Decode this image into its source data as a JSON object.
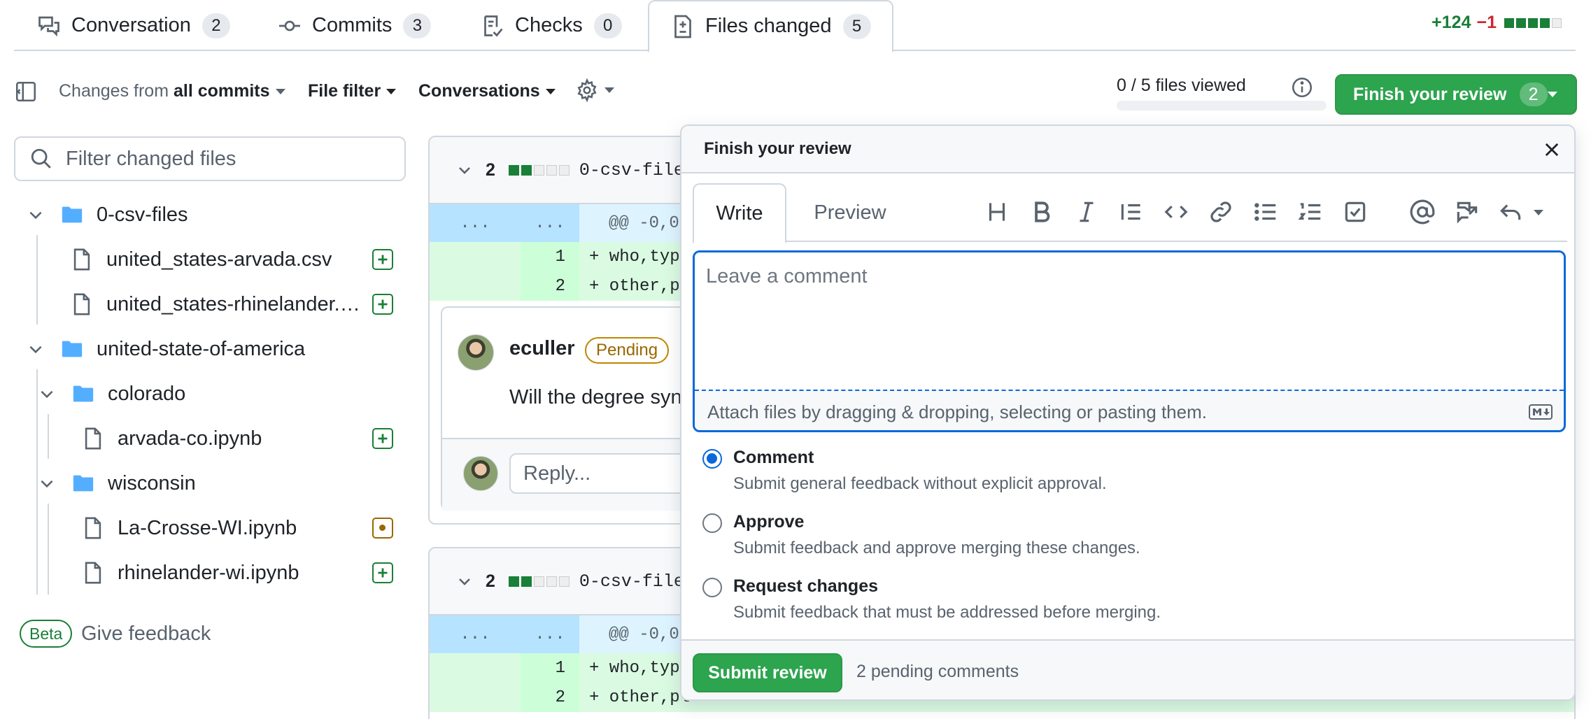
{
  "tabs": [
    {
      "label": "Conversation",
      "count": "2",
      "icon": "comment-discussion-icon"
    },
    {
      "label": "Commits",
      "count": "3",
      "icon": "git-commit-icon"
    },
    {
      "label": "Checks",
      "count": "0",
      "icon": "checklist-icon"
    },
    {
      "label": "Files changed",
      "count": "5",
      "icon": "file-diff-icon",
      "selected": true
    }
  ],
  "diffstat": {
    "additions": "+124",
    "deletions": "−1"
  },
  "toolbar": {
    "changes_prefix": "Changes from",
    "changes_value": "all commits",
    "file_filter": "File filter",
    "conversations": "Conversations",
    "files_viewed": "0 / 5 files viewed",
    "files_viewed_progress": 0,
    "finish_review": "Finish your review",
    "finish_review_count": "2"
  },
  "sidebar": {
    "filter_placeholder": "Filter changed files",
    "tree": [
      {
        "name": "0-csv-files",
        "type": "folder"
      },
      {
        "name": "united_states-arvada.csv",
        "type": "file",
        "status": "added"
      },
      {
        "name": "united_states-rhinelander.…",
        "type": "file",
        "status": "added"
      },
      {
        "name": "united-state-of-america",
        "type": "folder"
      },
      {
        "name": "colorado",
        "type": "folder"
      },
      {
        "name": "arvada-co.ipynb",
        "type": "file",
        "status": "added"
      },
      {
        "name": "wisconsin",
        "type": "folder"
      },
      {
        "name": "La-Crosse-WI.ipynb",
        "type": "file",
        "status": "modified"
      },
      {
        "name": "rhinelander-wi.ipynb",
        "type": "file",
        "status": "added"
      }
    ],
    "beta": "Beta",
    "feedback": "Give feedback"
  },
  "diffs": [
    {
      "count": "2",
      "filename": "0-csv-file",
      "hunk_dots": "...",
      "hunk_header": "@@ -0,0",
      "lines": [
        {
          "num": "1",
          "code": "+ who,type"
        },
        {
          "num": "2",
          "code": "+ other,pl"
        }
      ]
    },
    {
      "count": "2",
      "filename": "0-csv-file",
      "hunk_dots": "...",
      "hunk_header": "@@ -0,0",
      "lines": [
        {
          "num": "1",
          "code": "+ who,type"
        },
        {
          "num": "2",
          "code": "+ other,pl"
        }
      ]
    }
  ],
  "thread": {
    "author": "eculler",
    "status": "Pending",
    "comment": "Will the degree syn",
    "reply_placeholder": "Reply..."
  },
  "review": {
    "title": "Finish your review",
    "tab_write": "Write",
    "tab_preview": "Preview",
    "placeholder": "Leave a comment",
    "attach_hint": "Attach files by dragging & dropping, selecting or pasting them.",
    "options": [
      {
        "label": "Comment",
        "desc": "Submit general feedback without explicit approval.",
        "selected": true
      },
      {
        "label": "Approve",
        "desc": "Submit feedback and approve merging these changes.",
        "selected": false
      },
      {
        "label": "Request changes",
        "desc": "Submit feedback that must be addressed before merging.",
        "selected": false
      }
    ],
    "submit": "Submit review",
    "pending": "2 pending comments"
  },
  "colors": {
    "accent_green": "#2da44e",
    "link_blue": "#0969da",
    "pending_amber": "#9a6700"
  }
}
